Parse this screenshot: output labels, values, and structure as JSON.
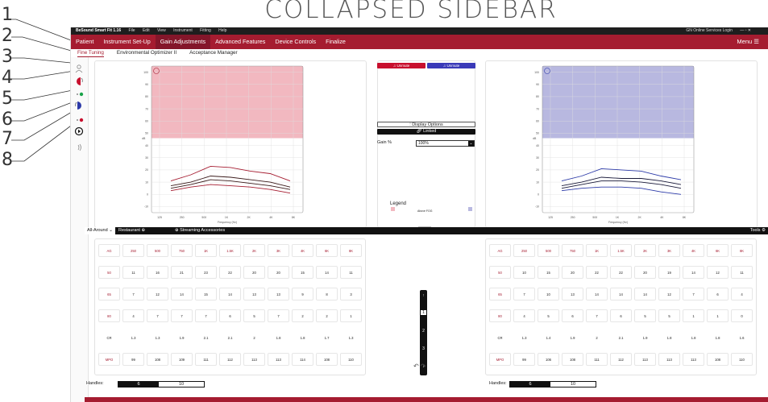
{
  "caption": "COLLAPSED SIDEBAR",
  "callouts": [
    "1",
    "2",
    "3",
    "4",
    "5",
    "6",
    "7",
    "8"
  ],
  "titlebar": {
    "app": "BeSound Smart Fit 1.16",
    "menus": [
      "File",
      "Edit",
      "View",
      "Instrument",
      "Fitting",
      "Help"
    ],
    "right": "GN Online Services Login"
  },
  "menubar": {
    "items": [
      "Patient",
      "Instrument Set-Up",
      "Gain Adjustments",
      "Advanced Features",
      "Device Controls",
      "Finalize"
    ],
    "active_index": 2,
    "menu_label": "Menu"
  },
  "subtabs": {
    "items": [
      "Fine Tuning",
      "Environmental Optimizer II",
      "Acceptance Manager"
    ],
    "active_index": 0
  },
  "sidebar": {
    "icons": [
      "person-icon",
      "left-ear-icon",
      "green-status-dot",
      "right-ear-icon",
      "red-status-dot",
      "play-icon",
      "sound-wave-icon"
    ]
  },
  "colors": {
    "brand": "#a51c30",
    "left": "#f2b8c0",
    "right": "#b8b8e0"
  },
  "controls": {
    "left_unmute": "Unmute",
    "right_unmute": "Unmute",
    "display_options": "Display Options",
    "linked": "Linked",
    "gain_label": "Gain %",
    "gain_value": "100%",
    "legend_title": "Legend",
    "legend_entry": "Above FOG"
  },
  "charts": {
    "ylabel": "dB",
    "xlabel": "Frequency (Hz)",
    "yticks": [
      "100",
      "90",
      "80",
      "70",
      "60",
      "50",
      "40",
      "30",
      "20",
      "10",
      "0",
      "-10"
    ],
    "xticks": [
      "125",
      "250",
      "500",
      "1K",
      "2K",
      "4K",
      "8K"
    ]
  },
  "chart_data": [
    {
      "type": "line",
      "title": "",
      "xlabel": "Frequency (Hz)",
      "ylabel": "dB",
      "ylim": [
        -15,
        105
      ],
      "x": [
        "250",
        "500",
        "1K",
        "2K",
        "4K",
        "6K",
        "8K"
      ],
      "series": [
        {
          "values": [
            11,
            16,
            23,
            22,
            19,
            17,
            11
          ]
        },
        {
          "values": [
            7,
            10,
            15,
            14,
            12,
            10,
            6
          ]
        },
        {
          "values": [
            3,
            6,
            8,
            7,
            6,
            4,
            1
          ]
        },
        {
          "values": [
            5,
            8,
            12,
            11,
            9,
            7,
            4
          ]
        }
      ]
    },
    {
      "type": "line",
      "title": "",
      "xlabel": "Frequency (Hz)",
      "ylabel": "dB",
      "ylim": [
        -15,
        105
      ],
      "x": [
        "250",
        "500",
        "1K",
        "2K",
        "4K",
        "6K",
        "8K"
      ],
      "series": [
        {
          "values": [
            11,
            15,
            21,
            20,
            19,
            15,
            12
          ]
        },
        {
          "values": [
            7,
            10,
            14,
            13,
            13,
            11,
            8
          ]
        },
        {
          "values": [
            3,
            5,
            6,
            6,
            5,
            2,
            0
          ]
        },
        {
          "values": [
            5,
            8,
            11,
            11,
            10,
            8,
            5
          ]
        }
      ]
    }
  ],
  "toolbar": {
    "program_active": "All-Around",
    "program_2": "Restaurant",
    "streaming": "Streaming Accessories",
    "tools": "Tools"
  },
  "left_grid": {
    "header": [
      "AG",
      "250",
      "500",
      "750",
      "1K",
      "1.5K",
      "2K",
      "3K",
      "4K",
      "6K",
      "8K"
    ],
    "rows": [
      [
        "50",
        "11",
        "16",
        "21",
        "23",
        "22",
        "20",
        "20",
        "15",
        "14",
        "11"
      ],
      [
        "65",
        "7",
        "12",
        "14",
        "15",
        "14",
        "13",
        "13",
        "9",
        "8",
        "3"
      ],
      [
        "80",
        "4",
        "7",
        "7",
        "7",
        "6",
        "5",
        "7",
        "2",
        "2",
        "1"
      ],
      [
        "CR",
        "1.3",
        "1.3",
        "1.9",
        "2.1",
        "2.1",
        "2",
        "1.8",
        "1.8",
        "1.7",
        "1.3"
      ],
      [
        "MPO",
        "99",
        "108",
        "109",
        "111",
        "112",
        "113",
        "113",
        "114",
        "108",
        "110"
      ]
    ]
  },
  "right_grid": {
    "header": [
      "AG",
      "250",
      "500",
      "750",
      "1K",
      "1.5K",
      "2K",
      "3K",
      "4K",
      "6K",
      "8K"
    ],
    "rows": [
      [
        "50",
        "10",
        "15",
        "20",
        "22",
        "22",
        "20",
        "19",
        "14",
        "12",
        "11"
      ],
      [
        "65",
        "7",
        "10",
        "13",
        "14",
        "14",
        "14",
        "12",
        "7",
        "6",
        "4"
      ],
      [
        "80",
        "4",
        "5",
        "6",
        "7",
        "6",
        "5",
        "5",
        "1",
        "1",
        "0"
      ],
      [
        "CR",
        "1.3",
        "1.4",
        "1.9",
        "2",
        "2.1",
        "1.9",
        "1.8",
        "1.8",
        "1.8",
        "1.6"
      ],
      [
        "MPO",
        "99",
        "106",
        "108",
        "111",
        "112",
        "113",
        "113",
        "113",
        "108",
        "110"
      ]
    ]
  },
  "handles": {
    "label": "Handles:",
    "a": "6",
    "b": "10"
  },
  "center_strip": [
    "↑",
    "1",
    "2",
    "3",
    "↓"
  ],
  "undo": "↶  ↷"
}
